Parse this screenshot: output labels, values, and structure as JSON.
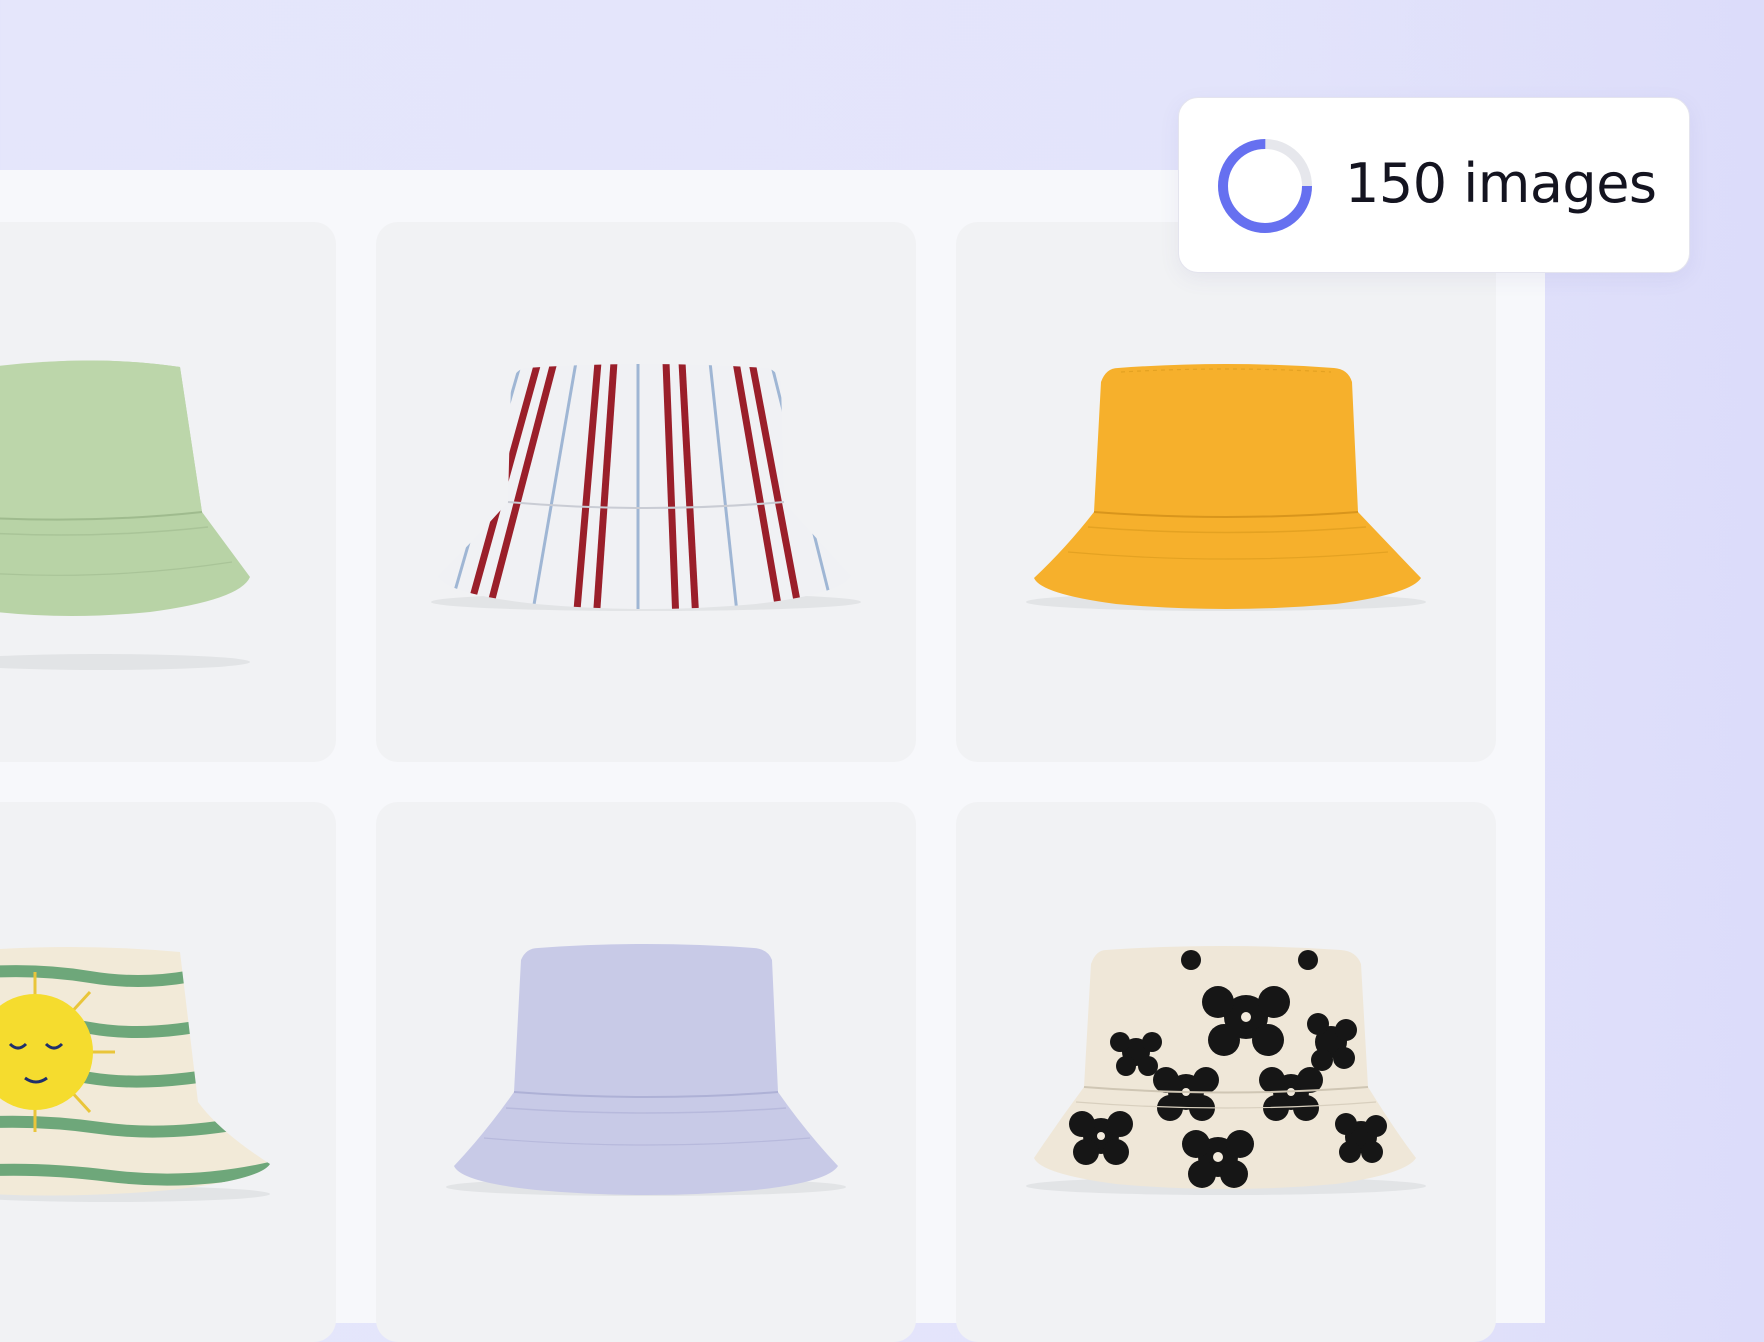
{
  "status_badge": {
    "count_text": "150 images",
    "progress_fraction": 0.75,
    "accent_color": "#6670f0",
    "track_color": "#e6e7ec"
  },
  "gallery": {
    "items": [
      {
        "name": "green-bucket-hat",
        "color": "#b9d4a8"
      },
      {
        "name": "striped-bucket-hat",
        "color": "#eef0f3"
      },
      {
        "name": "yellow-bucket-hat",
        "color": "#f8b630"
      },
      {
        "name": "sun-print-bucket-hat",
        "color": "#f2ead8"
      },
      {
        "name": "lavender-bucket-hat",
        "color": "#c9cbe8"
      },
      {
        "name": "flower-print-bucket-hat",
        "color": "#eee6d7"
      }
    ]
  }
}
